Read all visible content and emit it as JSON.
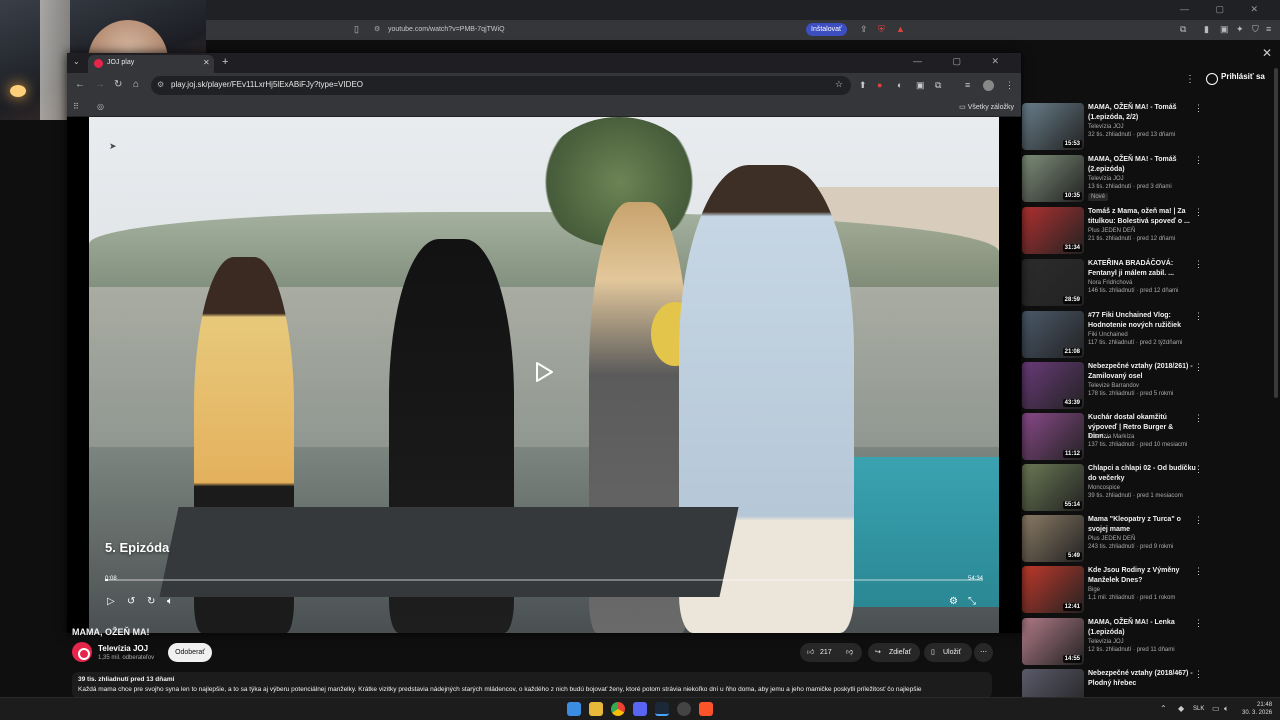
{
  "background_browser": {
    "url": "youtube.com/watch?v=PMB-7qjTWiQ",
    "install_label": "Inštalovať"
  },
  "foreground_browser": {
    "tab_title": "JOJ play",
    "url": "play.joj.sk/player/FEv11LxrHj5lExABiFJy?type=VIDEO",
    "all_bookmarks_label": "Všetky záložky"
  },
  "player": {
    "episode_label": "5. Epizóda",
    "time_current": "0:08",
    "time_total": "54:34",
    "progress_fraction": 0.003
  },
  "youtube": {
    "signin_label": "Prihlásiť sa",
    "video_title": "MAMA, OŽEŇ MA!",
    "channel_name": "Televízia JOJ",
    "channel_subs": "1,35 mil. odberateľov",
    "subscribe_label": "Odoberať",
    "likes": "217",
    "share_label": "Zdieľať",
    "save_label": "Uložiť",
    "views_date": "39 tis. zhliadnutí  pred 13 dňami",
    "description": "Každá mama chce pre svojho syna len to najlepšie, a to sa týka aj výberu potenciálnej manželky. Krátke vizitky predstavia nádejných starých mládencov, o každého z nich budú bojovať ženy, ktoré potom strávia niekoľko dní u ňho doma, aby jemu a jeho mamičke poskytli príležitosť čo najlepšie"
  },
  "recommendations": [
    {
      "title": "MAMA, OŽEŇ MA! - Tomáš (1.epizóda, 2/2)",
      "channel": "Televízia JOJ",
      "meta": "32 tis. zhliadnutí · pred 13 dňami",
      "duration": "15:53",
      "badge": "",
      "color": "#6a7f8c"
    },
    {
      "title": "MAMA, OŽEŇ MA! - Tomáš (2.epizóda)",
      "channel": "Televízia JOJ",
      "meta": "13 tis. zhliadnutí · pred 3 dňami",
      "duration": "10:35",
      "badge": "Nové",
      "color": "#7f8f7a"
    },
    {
      "title": "Tomáš z Mama, ožeň ma! | Za titulkou: Bolestivá spoveď o ...",
      "channel": "Plus JEDEN DEŇ",
      "meta": "21 tis. zhliadnutí · pred 12 dňami",
      "duration": "31:34",
      "badge": "",
      "color": "#b03030"
    },
    {
      "title": "KATEŘINA BRADÁČOVÁ: Fentanyl ji málem zabil. ...",
      "channel": "Nora Fridrichová",
      "meta": "146 tis. zhliadnutí · pred 12 dňami",
      "duration": "28:59",
      "badge": "",
      "color": "#2c2c2c"
    },
    {
      "title": "#77 Fiki Unchained Vlog: Hodnotenie nových ružičiek",
      "channel": "Fiki Unchained",
      "meta": "117 tis. zhliadnutí · pred 2 týždňami",
      "duration": "21:08",
      "badge": "",
      "color": "#4b5a6b"
    },
    {
      "title": "Nebezpečné vztahy (2018/261) - Zamilovaný osel",
      "channel": "Televize Barrandov",
      "meta": "178 tis. zhliadnutí · pred 5 rokmi",
      "duration": "43:39",
      "badge": "",
      "color": "#6a3b7a"
    },
    {
      "title": "Kuchár dostal okamžitú výpoveď | Retro Burger & Dinn...",
      "channel": "Televízia Markíza",
      "meta": "137 tis. zhliadnutí · pred 10 mesiacmi",
      "duration": "11:12",
      "badge": "",
      "color": "#8a4a8a"
    },
    {
      "title": "Chlapci a chlapi 02 - Od budíčku do večerky",
      "channel": "Moncospice",
      "meta": "39 tis. zhliadnutí · pred 1 mesiacom",
      "duration": "55:14",
      "badge": "",
      "color": "#6b7a55"
    },
    {
      "title": "Mama \"Kleopatry z Turca\" o svojej mame",
      "channel": "Plus JEDEN DEŇ",
      "meta": "243 tis. zhliadnutí · pred 9 rokmi",
      "duration": "5:49",
      "badge": "",
      "color": "#8c7c66"
    },
    {
      "title": "Kde Jsou Rodiny z Výměny Manželek Dnes?",
      "channel": "Bige",
      "meta": "1,1 mil. zhliadnutí · pred 1 rokom",
      "duration": "12:41",
      "badge": "",
      "color": "#c0392b"
    },
    {
      "title": "MAMA, OŽEŇ MA! - Lenka (1.epizóda)",
      "channel": "Televízia JOJ",
      "meta": "12 tis. zhliadnutí · pred 11 dňami",
      "duration": "14:55",
      "badge": "",
      "color": "#b07a88"
    },
    {
      "title": "Nebezpečné vztahy (2018/467) - Plodný hřebec",
      "channel": "",
      "meta": "",
      "duration": "",
      "badge": "",
      "color": "#5a5a6a"
    }
  ],
  "taskbar": {
    "lang": "SLK",
    "time": "21:48",
    "date": "30. 3. 2026"
  }
}
